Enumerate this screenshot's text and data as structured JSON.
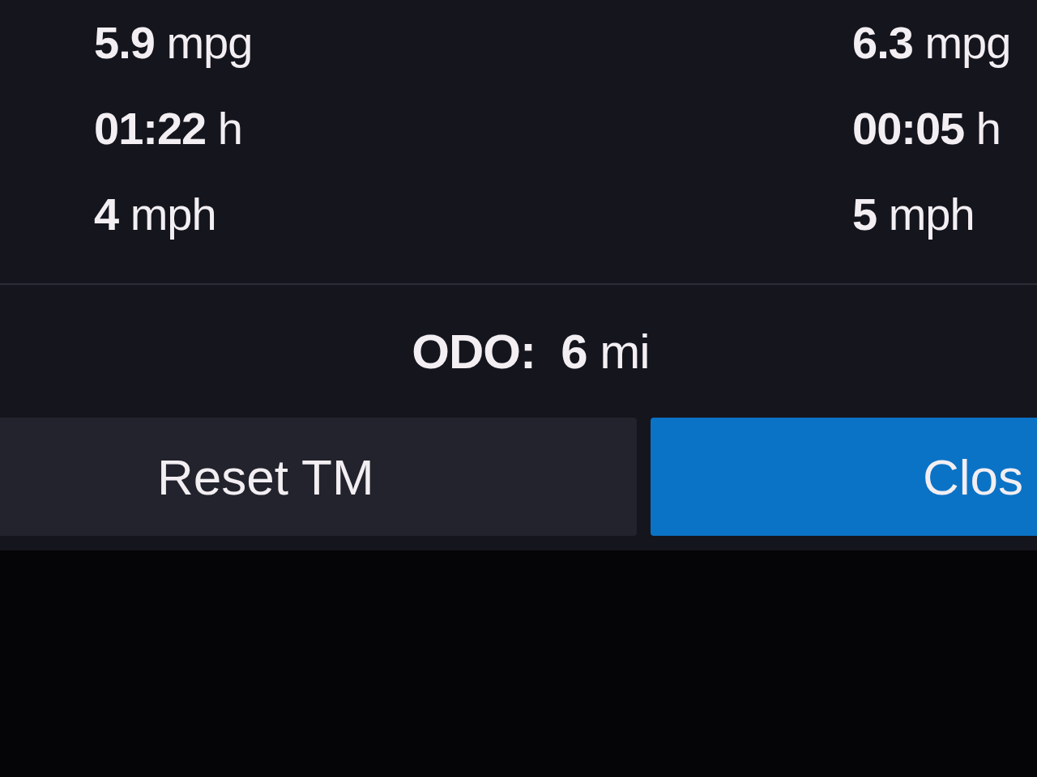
{
  "trip_columns": [
    {
      "readings": [
        "**5.9** mpg",
        "**01:22** h",
        "**4** mph"
      ]
    },
    {
      "readings": [
        "**6.3** mpg",
        "**00:05** h",
        "**5** mph"
      ]
    }
  ],
  "odometer": "**ODO:**  **6** mi",
  "buttons": [
    {
      "label": "Reset TM",
      "kind": "secondary"
    },
    {
      "label": "Clos",
      "kind": "primary"
    }
  ]
}
